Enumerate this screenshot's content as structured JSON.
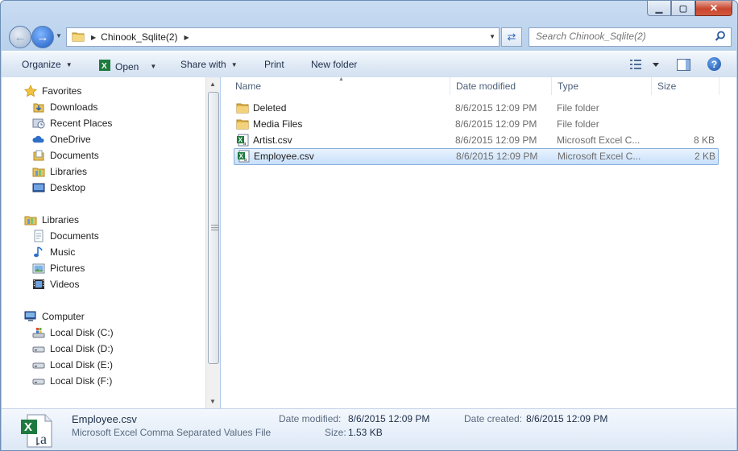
{
  "window": {
    "caption": {
      "minimize": "▁",
      "maximize": "▢",
      "close": "✕"
    }
  },
  "nav": {
    "back_icon": "back-arrow-icon",
    "forward_icon": "forward-arrow-icon",
    "breadcrumb": "Chinook_Sqlite(2)",
    "search_placeholder": "Search Chinook_Sqlite(2)"
  },
  "toolbar": {
    "organize": "Organize",
    "open": "Open",
    "share_with": "Share with",
    "print": "Print",
    "new_folder": "New folder",
    "help": "?"
  },
  "sidebar": {
    "favorites": {
      "label": "Favorites",
      "items": [
        {
          "label": "Downloads",
          "icon": "downloads-icon"
        },
        {
          "label": "Recent Places",
          "icon": "recent-places-icon"
        },
        {
          "label": "OneDrive",
          "icon": "onedrive-icon"
        },
        {
          "label": "Documents",
          "icon": "documents-icon"
        },
        {
          "label": "Libraries",
          "icon": "libraries-icon"
        },
        {
          "label": "Desktop",
          "icon": "desktop-icon"
        }
      ]
    },
    "libraries": {
      "label": "Libraries",
      "items": [
        {
          "label": "Documents",
          "icon": "documents-icon"
        },
        {
          "label": "Music",
          "icon": "music-icon"
        },
        {
          "label": "Pictures",
          "icon": "pictures-icon"
        },
        {
          "label": "Videos",
          "icon": "videos-icon"
        }
      ]
    },
    "computer": {
      "label": "Computer",
      "items": [
        {
          "label": "Local Disk (C:)",
          "icon": "system-drive-icon"
        },
        {
          "label": "Local Disk (D:)",
          "icon": "drive-icon"
        },
        {
          "label": "Local Disk (E:)",
          "icon": "drive-icon"
        },
        {
          "label": "Local Disk (F:)",
          "icon": "drive-icon"
        }
      ]
    }
  },
  "columns": {
    "name": "Name",
    "date_modified": "Date modified",
    "type": "Type",
    "size": "Size"
  },
  "files": [
    {
      "name": "Deleted",
      "date": "8/6/2015 12:09 PM",
      "type": "File folder",
      "size": "",
      "icon": "folder-icon",
      "selected": false
    },
    {
      "name": "Media Files",
      "date": "8/6/2015 12:09 PM",
      "type": "File folder",
      "size": "",
      "icon": "folder-icon",
      "selected": false
    },
    {
      "name": "Artist.csv",
      "date": "8/6/2015 12:09 PM",
      "type": "Microsoft Excel C...",
      "size": "8 KB",
      "icon": "excel-csv-icon",
      "selected": false
    },
    {
      "name": "Employee.csv",
      "date": "8/6/2015 12:09 PM",
      "type": "Microsoft Excel C...",
      "size": "2 KB",
      "icon": "excel-csv-icon",
      "selected": true
    }
  ],
  "details": {
    "filename": "Employee.csv",
    "filetype": "Microsoft Excel Comma Separated Values File",
    "date_modified_label": "Date modified:",
    "date_modified": "8/6/2015 12:09 PM",
    "date_created_label": "Date created:",
    "date_created": "8/6/2015 12:09 PM",
    "size_label": "Size:",
    "size": "1.53 KB"
  }
}
